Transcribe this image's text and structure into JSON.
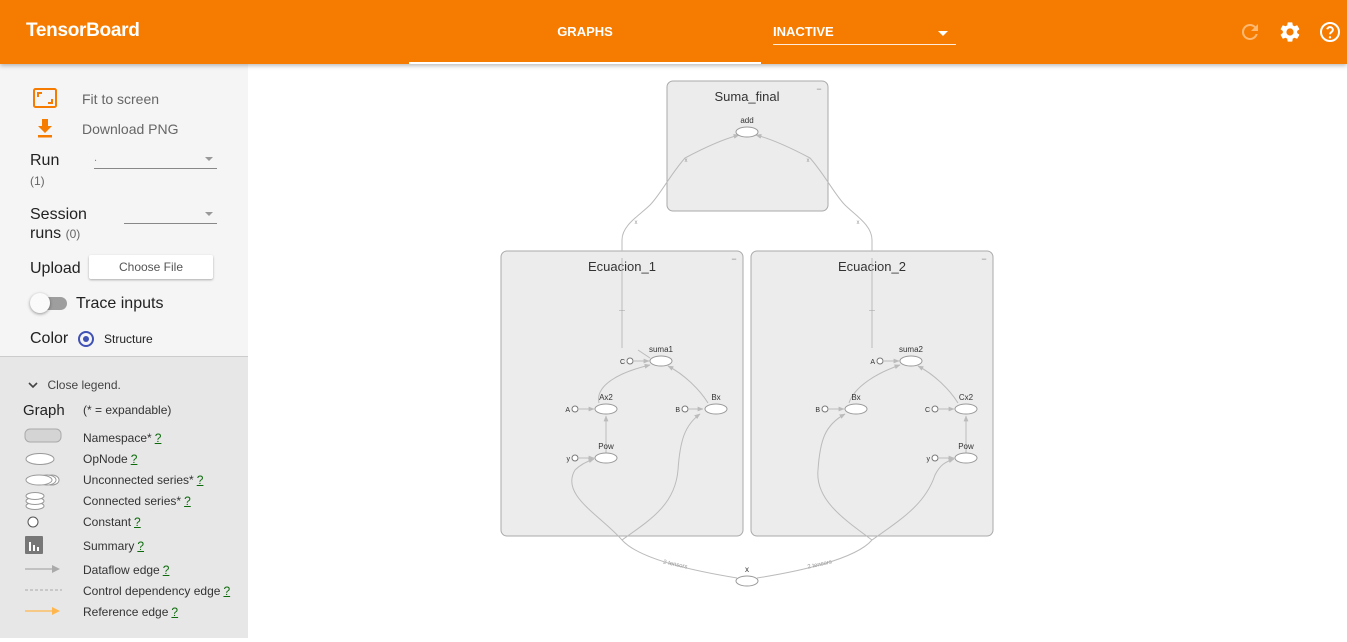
{
  "header": {
    "brand": "TensorBoard",
    "tab": "GRAPHS",
    "dropdown_value": "INACTIVE",
    "icons": [
      "refresh-icon",
      "settings-gear-icon",
      "help-icon"
    ]
  },
  "sidebar": {
    "fit_to_screen": "Fit to screen",
    "download_png": "Download PNG",
    "run_label": "Run",
    "run_count": "(1)",
    "run_value": ".",
    "session_label_line1": "Session",
    "session_label_line2": "runs",
    "session_count": "(0)",
    "upload_label": "Upload",
    "choose_file": "Choose File",
    "trace_inputs": "Trace inputs",
    "trace_inputs_on": false,
    "color_label": "Color",
    "color_option": "Structure"
  },
  "legend": {
    "toggle": "Close legend.",
    "title": "Graph",
    "subtitle": "(* = expandable)",
    "help_mark": "?",
    "items": [
      {
        "label": "Namespace*"
      },
      {
        "label": "OpNode"
      },
      {
        "label": "Unconnected series*"
      },
      {
        "label": "Connected series*"
      },
      {
        "label": "Constant"
      },
      {
        "label": "Summary"
      },
      {
        "label": "Dataflow edge"
      },
      {
        "label": "Control dependency edge"
      },
      {
        "label": "Reference edge"
      }
    ]
  },
  "graph": {
    "namespaces": [
      "Suma_final",
      "Ecuacion_1",
      "Ecuacion_2"
    ],
    "collapse_mark": "−",
    "nodes": {
      "add": "add",
      "suma1": "suma1",
      "ax2": "Ax2",
      "bx_1": "Bx",
      "pow_1": "Pow",
      "suma2": "suma2",
      "bx_2": "Bx",
      "cx2": "Cx2",
      "pow_2": "Pow",
      "x": "x"
    },
    "constants": {
      "c_1": "C",
      "a_1": "A",
      "b_1": "B",
      "y_1": "y",
      "a_2": "A",
      "b_2": "B",
      "c_2": "C",
      "y_2": "y"
    },
    "edge_labels": [
      "x",
      "x",
      "x",
      "x",
      "—",
      "—",
      "2 tensors",
      "2 tensors"
    ]
  },
  "colors": {
    "header": "#f57c00",
    "sidebar": "#f5f5f5",
    "legend": "#e7e7e7",
    "namespace_fill": "#ececec",
    "namespace_stroke": "#aaaaaa",
    "edge": "#bbbbbb",
    "reference_edge": "#ffb74d",
    "radio": "#3f51b5",
    "help_link": "#0b6b0b"
  }
}
